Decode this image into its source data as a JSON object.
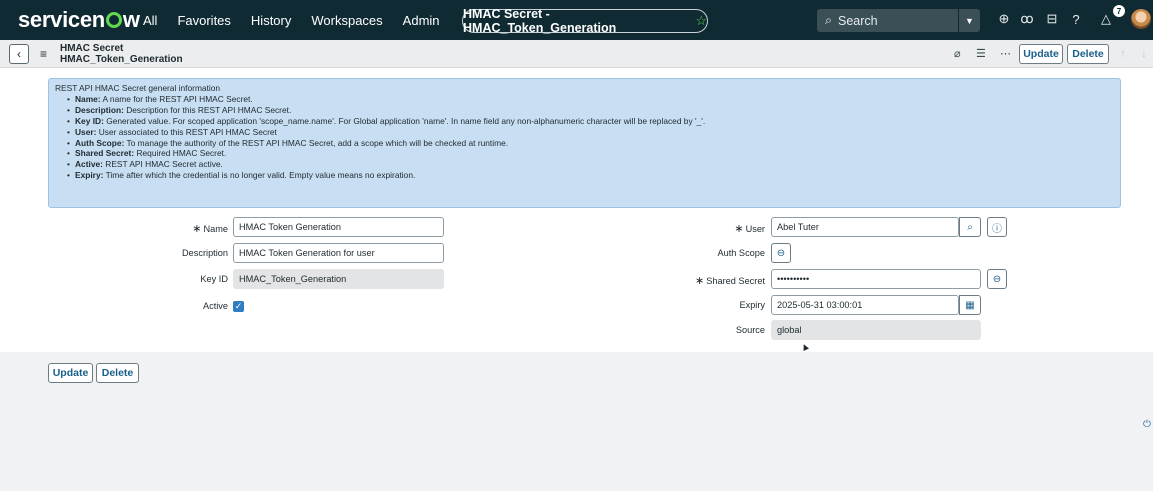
{
  "topnav": {
    "brand": "servicenow",
    "links": [
      "All",
      "Favorites",
      "History",
      "Workspaces",
      "Admin"
    ],
    "record_title": "HMAC Secret - HMAC_Token_Generation",
    "search_placeholder": "Search",
    "notifications_count": "7",
    "icons": [
      "globe-icon",
      "chat-icon",
      "inbox-icon",
      "help-icon",
      "bell-icon"
    ]
  },
  "formbar": {
    "table": "HMAC Secret",
    "record": "HMAC_Token_Generation",
    "update_label": "Update",
    "delete_label": "Delete"
  },
  "info": {
    "heading": "REST API HMAC Secret general information",
    "items": [
      {
        "term": "Name:",
        "desc": "A name for the REST API HMAC Secret."
      },
      {
        "term": "Description:",
        "desc": "Description for this REST API HMAC Secret."
      },
      {
        "term": "Key ID:",
        "desc": "Generated value. For scoped application 'scope_name.name'. For Global application 'name'. In name field any non-alphanumeric character will be replaced by '_'."
      },
      {
        "term": "User:",
        "desc": "User associated to this REST API HMAC Secret"
      },
      {
        "term": "Auth Scope:",
        "desc": "To manage the authority of the REST API HMAC Secret, add a scope which will be checked at runtime."
      },
      {
        "term": "Shared Secret:",
        "desc": "Required HMAC Secret."
      },
      {
        "term": "Active:",
        "desc": "REST API HMAC Secret active."
      },
      {
        "term": "Expiry:",
        "desc": "Time after which the credential is no longer valid. Empty value means no expiration."
      }
    ]
  },
  "fields": {
    "name_label": "Name",
    "name_value": "HMAC Token Generation",
    "description_label": "Description",
    "description_value": "HMAC Token Generation for user",
    "keyid_label": "Key ID",
    "keyid_value": "HMAC_Token_Generation",
    "active_label": "Active",
    "user_label": "User",
    "user_value": "Abel Tuter",
    "authscope_label": "Auth Scope",
    "secret_label": "Shared Secret",
    "secret_value": "••••••••••",
    "expiry_label": "Expiry",
    "expiry_value": "2025-05-31 03:00:01",
    "source_label": "Source",
    "source_value": "global"
  },
  "footer": {
    "update_label": "Update",
    "delete_label": "Delete"
  },
  "colors": {
    "nav_bg": "#0f2a33",
    "accent_green": "#62d84e",
    "info_bg": "#c8dff3",
    "button_text": "#1a5f8a"
  }
}
